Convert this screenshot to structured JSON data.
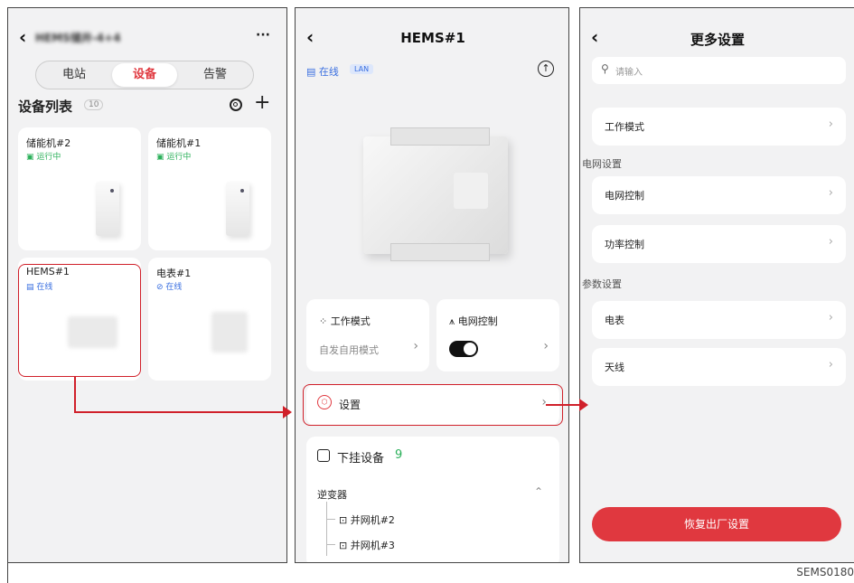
{
  "screen1": {
    "title": "HEMS储井-4+4",
    "more": "···",
    "tabs": [
      "电站",
      "设备",
      "告警"
    ],
    "active_tab": "设备",
    "list_title": "设备列表",
    "count": "10",
    "devices": [
      {
        "name": "储能机#2",
        "status": "运行中"
      },
      {
        "name": "储能机#1",
        "status": "运行中"
      },
      {
        "name": "HEMS#1",
        "status": "在线"
      },
      {
        "name": "电表#1",
        "status": "在线"
      }
    ]
  },
  "screen2": {
    "title": "HEMS#1",
    "status": "在线",
    "lan": "LAN",
    "work_mode": {
      "label": "工作模式",
      "value": "自发自用模式"
    },
    "grid_control": {
      "label": "电网控制"
    },
    "settings": "设置",
    "sub_devices": {
      "label": "下挂设备",
      "count": "9"
    },
    "inverter": "逆变器",
    "inverters": [
      "并网机#2",
      "并网机#3"
    ]
  },
  "screen3": {
    "title": "更多设置",
    "search_placeholder": "请输入",
    "items_top": [
      "工作模式"
    ],
    "section_grid": "电网设置",
    "items_grid": [
      "电网控制",
      "功率控制"
    ],
    "section_param": "参数设置",
    "items_param": [
      "电表",
      "天线"
    ],
    "reset": "恢复出厂设置"
  },
  "figure_code": "SEMS0180",
  "colors": {
    "accent": "#e0383f",
    "online": "#3a6fe0",
    "running": "#2bb05a",
    "highlight": "#d0202a"
  }
}
